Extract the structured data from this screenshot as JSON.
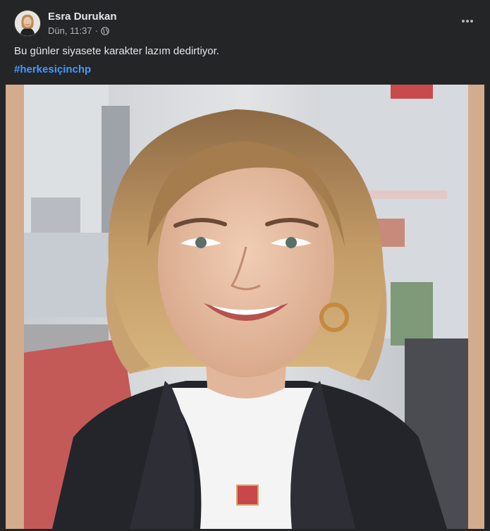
{
  "post": {
    "author": "Esra Durukan",
    "time": "Dün, 11:37",
    "separator": "·",
    "privacy_icon": "globe-icon",
    "more_icon": "more-options-icon",
    "text": "Bu günler siyasete karakter lazım dedirtiyor.",
    "hashtag": "#herkesiçinchp"
  },
  "colors": {
    "background": "#242526",
    "text_primary": "#e4e6eb",
    "text_secondary": "#b0b3b8",
    "hashtag": "#4599ff",
    "photo_border": "#d3ab8d"
  }
}
